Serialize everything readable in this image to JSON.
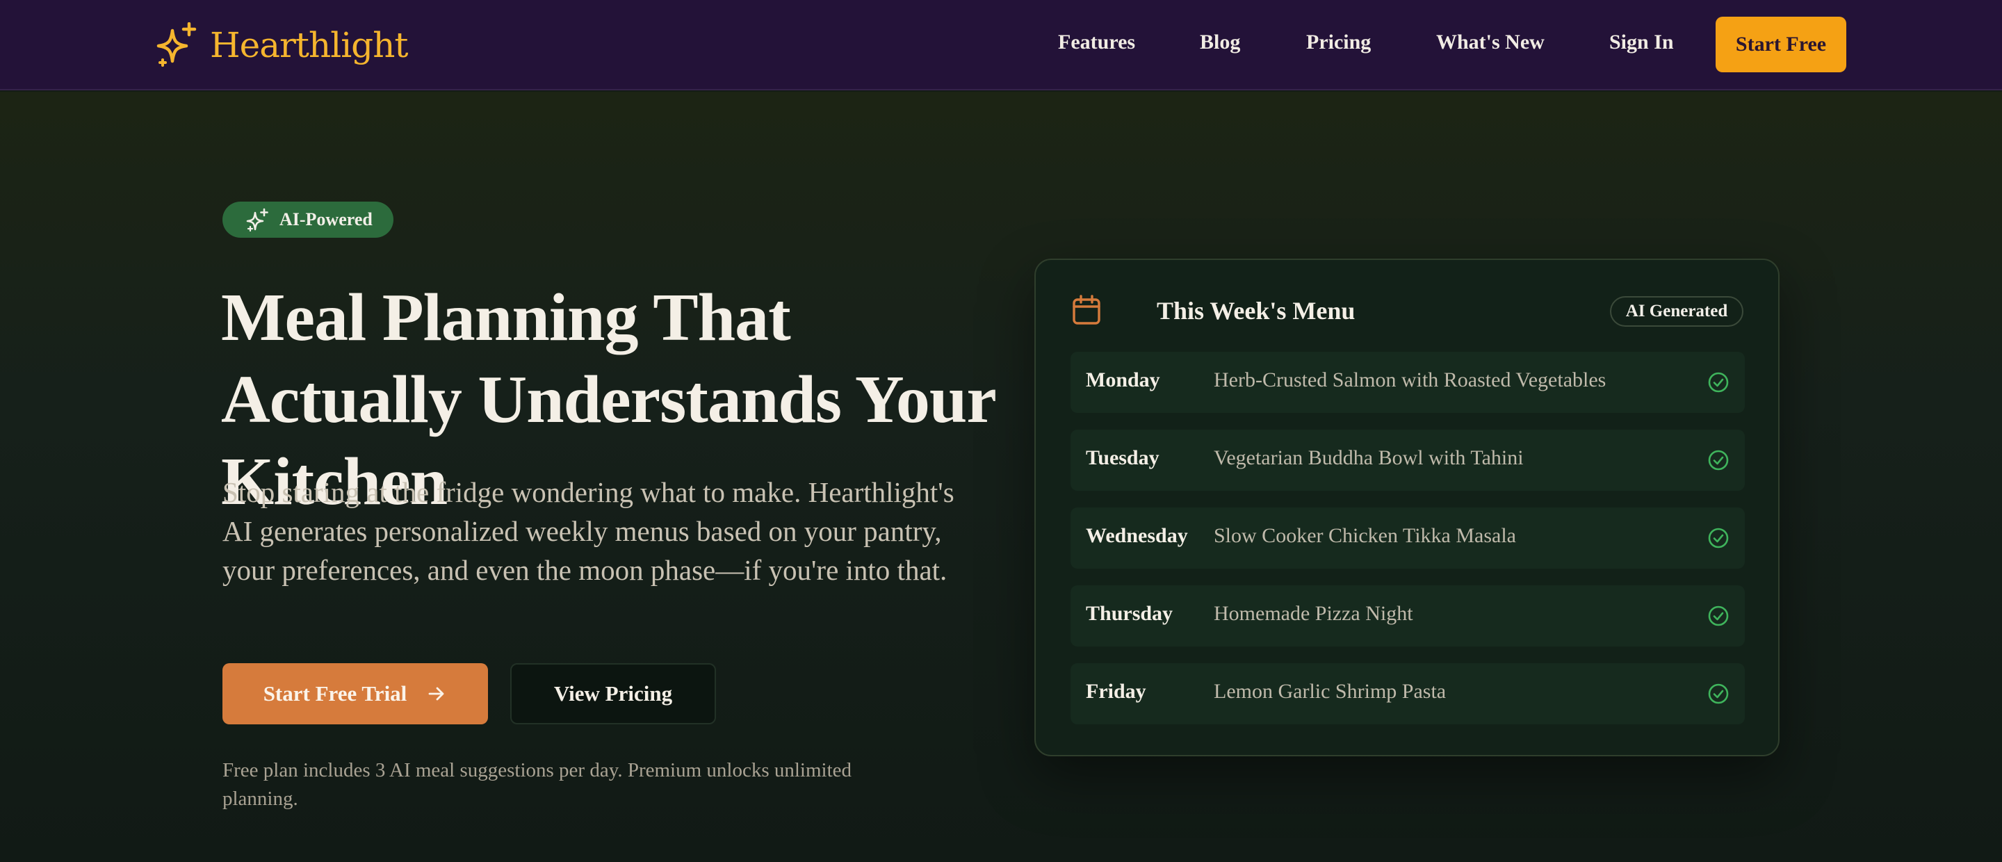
{
  "brand": {
    "name": "Hearthlight",
    "logo_icon": "sparkle-icon",
    "color": "#f5b52e"
  },
  "nav": {
    "links": [
      "Features",
      "Blog",
      "Pricing",
      "What's New",
      "Sign In"
    ],
    "cta": "Start Free"
  },
  "hero": {
    "badge": "AI-Powered",
    "headline": "Meal Planning That Actually Understands Your Kitchen",
    "subtext": "Stop staring at the fridge wondering what to make. Hearthlight's AI generates personalized weekly menus based on your pantry, your preferences, and even the moon phase—if you're into that.",
    "primary_cta": "Start Free Trial",
    "secondary_cta": "View Pricing",
    "footnote": "Free plan includes 3 AI meal suggestions per day. Premium unlocks unlimited planning."
  },
  "menu_card": {
    "title": "This Week's Menu",
    "tag": "AI Generated",
    "icon": "calendar-icon",
    "days": [
      {
        "day": "Monday",
        "meal": "Herb-Crusted Salmon with Roasted Vegetables"
      },
      {
        "day": "Tuesday",
        "meal": "Vegetarian Buddha Bowl with Tahini"
      },
      {
        "day": "Wednesday",
        "meal": "Slow Cooker Chicken Tikka Masala"
      },
      {
        "day": "Thursday",
        "meal": "Homemade Pizza Night"
      },
      {
        "day": "Friday",
        "meal": "Lemon Garlic Shrimp Pasta"
      }
    ]
  },
  "colors": {
    "nav_bg": "#231238",
    "accent_orange": "#d67b3c",
    "accent_amber": "#f5a114",
    "badge_green": "#2c6b3c",
    "check_green": "#3fb45c"
  }
}
